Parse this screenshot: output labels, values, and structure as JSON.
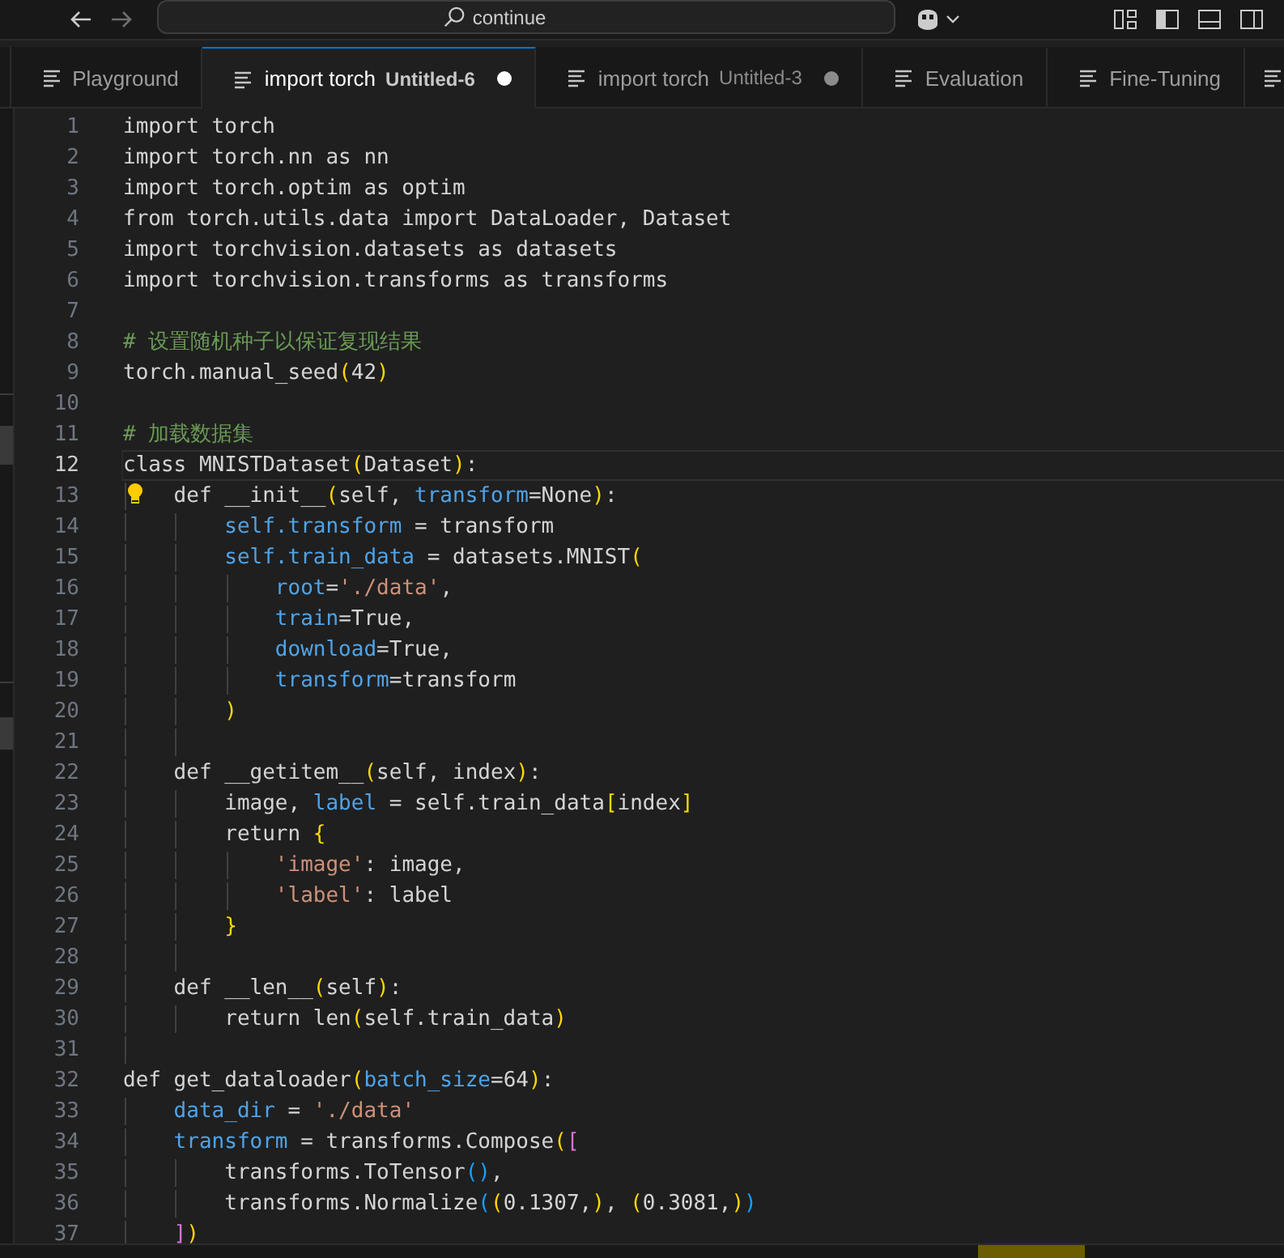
{
  "command_center": {
    "label": "continue"
  },
  "tabs": [
    {
      "label": "Playground",
      "selected": false,
      "dirty": false
    },
    {
      "label": "import torch",
      "description": "Untitled-6",
      "selected": true,
      "dirty": true
    },
    {
      "label": "import torch",
      "description": "Untitled-3",
      "selected": false,
      "dirty": true
    },
    {
      "label": "Evaluation",
      "selected": false,
      "dirty": false
    },
    {
      "label": "Fine-Tuning",
      "selected": false,
      "dirty": false
    }
  ],
  "editor": {
    "lines": [
      {
        "number": "1",
        "current": false,
        "tokens": [
          {
            "kind": "plain",
            "text": "import torch"
          }
        ]
      },
      {
        "number": "2",
        "current": false,
        "tokens": [
          {
            "kind": "plain",
            "text": "import torch.nn as nn"
          }
        ]
      },
      {
        "number": "3",
        "current": false,
        "tokens": [
          {
            "kind": "plain",
            "text": "import torch.optim as optim"
          }
        ]
      },
      {
        "number": "4",
        "current": false,
        "tokens": [
          {
            "kind": "plain",
            "text": "from torch.utils.data import DataLoader, Dataset"
          }
        ]
      },
      {
        "number": "5",
        "current": false,
        "tokens": [
          {
            "kind": "plain",
            "text": "import torchvision.datasets as datasets"
          }
        ]
      },
      {
        "number": "6",
        "current": false,
        "tokens": [
          {
            "kind": "plain",
            "text": "import torchvision.transforms as transforms"
          }
        ]
      },
      {
        "number": "7",
        "current": false
      },
      {
        "number": "8",
        "current": false,
        "tokens": [
          {
            "kind": "comment",
            "text": "# 设置随机种子以保证复现结果"
          }
        ]
      },
      {
        "number": "9",
        "current": false,
        "tokens": [
          {
            "kind": "plain",
            "text": "torch.manual_seed"
          },
          {
            "kind": "bracket1",
            "text": "("
          },
          {
            "kind": "plain",
            "text": "42"
          },
          {
            "kind": "bracket1",
            "text": ")"
          }
        ]
      },
      {
        "number": "10",
        "current": false
      },
      {
        "number": "11",
        "current": false,
        "tokens": [
          {
            "kind": "comment",
            "text": "# 加载数据集"
          }
        ]
      },
      {
        "number": "12",
        "current": true,
        "tokens": [
          {
            "kind": "plain",
            "text": "class MNISTDataset"
          },
          {
            "kind": "bracket1",
            "text": "("
          },
          {
            "kind": "plain",
            "text": "Dataset"
          },
          {
            "kind": "bracket1",
            "text": ")"
          },
          {
            "kind": "plain",
            "text": ":"
          }
        ]
      },
      {
        "number": "13",
        "current": false,
        "tokens": [
          {
            "kind": "lightbulb"
          },
          {
            "kind": "plain",
            "text": "    def __init__"
          },
          {
            "kind": "bracket1",
            "text": "("
          },
          {
            "kind": "plain",
            "text": "self, "
          },
          {
            "kind": "param",
            "text": "transform"
          },
          {
            "kind": "plain",
            "text": "=None"
          },
          {
            "kind": "bracket1",
            "text": ")"
          },
          {
            "kind": "plain",
            "text": ":"
          }
        ]
      },
      {
        "number": "14",
        "current": false,
        "tokens": [
          {
            "kind": "param",
            "text": "        self.transform"
          },
          {
            "kind": "plain",
            "text": " = transform"
          }
        ]
      },
      {
        "number": "15",
        "current": false,
        "tokens": [
          {
            "kind": "param",
            "text": "        self.train_data"
          },
          {
            "kind": "plain",
            "text": " = datasets.MNIST"
          },
          {
            "kind": "bracket1",
            "text": "("
          }
        ]
      },
      {
        "number": "16",
        "current": false,
        "tokens": [
          {
            "kind": "param",
            "text": "            root"
          },
          {
            "kind": "plain",
            "text": "="
          },
          {
            "kind": "string",
            "text": "'./data'"
          },
          {
            "kind": "plain",
            "text": ","
          }
        ]
      },
      {
        "number": "17",
        "current": false,
        "tokens": [
          {
            "kind": "param",
            "text": "            train"
          },
          {
            "kind": "plain",
            "text": "=True,"
          }
        ]
      },
      {
        "number": "18",
        "current": false,
        "tokens": [
          {
            "kind": "param",
            "text": "            download"
          },
          {
            "kind": "plain",
            "text": "=True,"
          }
        ]
      },
      {
        "number": "19",
        "current": false,
        "tokens": [
          {
            "kind": "param",
            "text": "            transform"
          },
          {
            "kind": "plain",
            "text": "=transform"
          }
        ]
      },
      {
        "number": "20",
        "current": false,
        "tokens": [
          {
            "kind": "bracket1",
            "text": "        )"
          }
        ]
      },
      {
        "number": "21",
        "current": false
      },
      {
        "number": "22",
        "current": false,
        "tokens": [
          {
            "kind": "plain",
            "text": "    def __getitem__"
          },
          {
            "kind": "bracket1",
            "text": "("
          },
          {
            "kind": "plain",
            "text": "self, index"
          },
          {
            "kind": "bracket1",
            "text": ")"
          },
          {
            "kind": "plain",
            "text": ":"
          }
        ]
      },
      {
        "number": "23",
        "current": false,
        "tokens": [
          {
            "kind": "plain",
            "text": "        image, "
          },
          {
            "kind": "param",
            "text": "label"
          },
          {
            "kind": "plain",
            "text": " = self.train_data"
          },
          {
            "kind": "bracket1",
            "text": "["
          },
          {
            "kind": "plain",
            "text": "index"
          },
          {
            "kind": "bracket1",
            "text": "]"
          }
        ]
      },
      {
        "number": "24",
        "current": false,
        "tokens": [
          {
            "kind": "plain",
            "text": "        return "
          },
          {
            "kind": "bracket1",
            "text": "{"
          }
        ]
      },
      {
        "number": "25",
        "current": false,
        "tokens": [
          {
            "kind": "string",
            "text": "            'image'"
          },
          {
            "kind": "plain",
            "text": ": image,"
          }
        ]
      },
      {
        "number": "26",
        "current": false,
        "tokens": [
          {
            "kind": "string",
            "text": "            'label'"
          },
          {
            "kind": "plain",
            "text": ": label"
          }
        ]
      },
      {
        "number": "27",
        "current": false,
        "tokens": [
          {
            "kind": "bracket1",
            "text": "        }"
          }
        ]
      },
      {
        "number": "28",
        "current": false
      },
      {
        "number": "29",
        "current": false,
        "tokens": [
          {
            "kind": "plain",
            "text": "    def __len__"
          },
          {
            "kind": "bracket1",
            "text": "("
          },
          {
            "kind": "plain",
            "text": "self"
          },
          {
            "kind": "bracket1",
            "text": ")"
          },
          {
            "kind": "plain",
            "text": ":"
          }
        ]
      },
      {
        "number": "30",
        "current": false,
        "tokens": [
          {
            "kind": "plain",
            "text": "        return len"
          },
          {
            "kind": "bracket1",
            "text": "("
          },
          {
            "kind": "plain",
            "text": "self.train_data"
          },
          {
            "kind": "bracket1",
            "text": ")"
          }
        ]
      },
      {
        "number": "31",
        "current": false
      },
      {
        "number": "32",
        "current": false,
        "tokens": [
          {
            "kind": "plain",
            "text": "def get_dataloader"
          },
          {
            "kind": "bracket1",
            "text": "("
          },
          {
            "kind": "param",
            "text": "batch_size"
          },
          {
            "kind": "plain",
            "text": "=64"
          },
          {
            "kind": "bracket1",
            "text": ")"
          },
          {
            "kind": "plain",
            "text": ":"
          }
        ]
      },
      {
        "number": "33",
        "current": false,
        "tokens": [
          {
            "kind": "param",
            "text": "    data_dir"
          },
          {
            "kind": "plain",
            "text": " = "
          },
          {
            "kind": "string",
            "text": "'./data'"
          }
        ]
      },
      {
        "number": "34",
        "current": false,
        "tokens": [
          {
            "kind": "param",
            "text": "    transform"
          },
          {
            "kind": "plain",
            "text": " = transforms.Compose"
          },
          {
            "kind": "bracket1",
            "text": "("
          },
          {
            "kind": "bracket2",
            "text": "["
          }
        ]
      },
      {
        "number": "35",
        "current": false,
        "tokens": [
          {
            "kind": "plain",
            "text": "        transforms.ToTensor"
          },
          {
            "kind": "bracket3",
            "text": "()"
          },
          {
            "kind": "plain",
            "text": ","
          }
        ]
      },
      {
        "number": "36",
        "current": false,
        "tokens": [
          {
            "kind": "plain",
            "text": "        transforms.Normalize"
          },
          {
            "kind": "bracket3",
            "text": "("
          },
          {
            "kind": "bracket1",
            "text": "("
          },
          {
            "kind": "plain",
            "text": "0.1307,"
          },
          {
            "kind": "bracket1",
            "text": ")"
          },
          {
            "kind": "plain",
            "text": ", "
          },
          {
            "kind": "bracket1",
            "text": "("
          },
          {
            "kind": "plain",
            "text": "0.3081,"
          },
          {
            "kind": "bracket1",
            "text": ")"
          },
          {
            "kind": "bracket3",
            "text": ")"
          }
        ]
      },
      {
        "number": "37",
        "current": false,
        "tokens": [
          {
            "kind": "bracket2",
            "text": "    ]"
          },
          {
            "kind": "bracket1",
            "text": ")"
          }
        ]
      }
    ]
  }
}
